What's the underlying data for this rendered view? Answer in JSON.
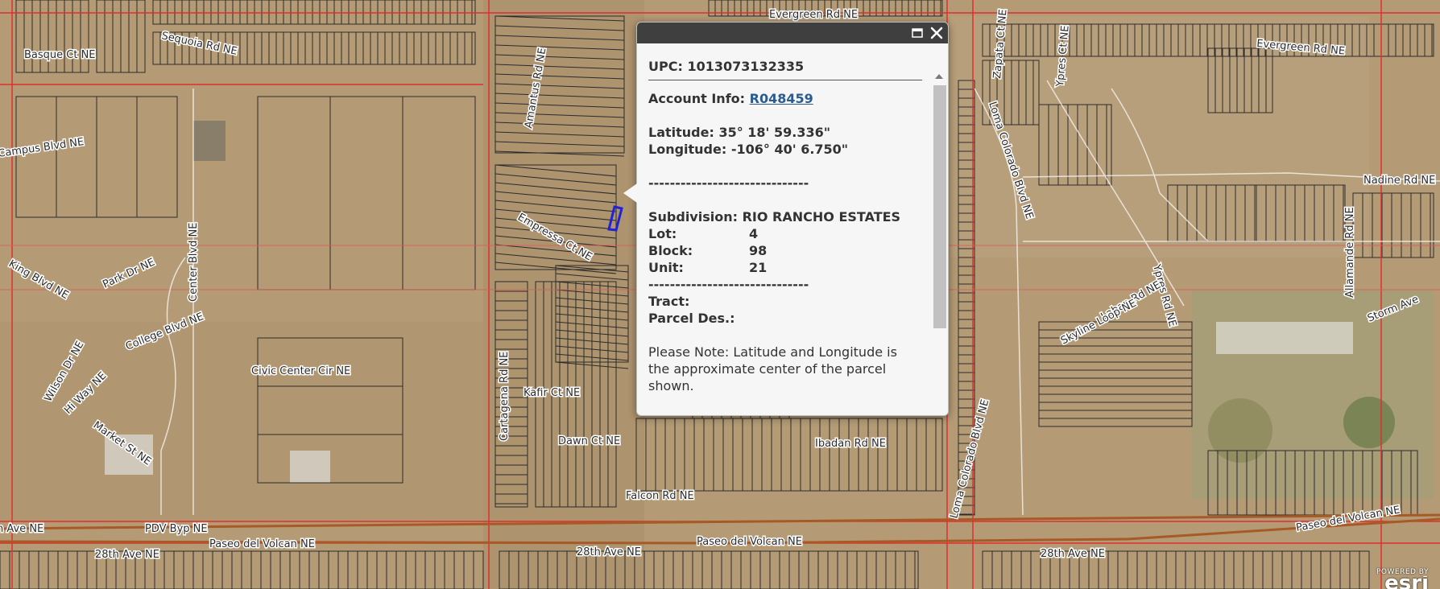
{
  "map": {
    "street_labels": [
      "Basque Ct NE",
      "Sequoia Rd NE",
      "Evergreen Rd NE",
      "Evergreen Rd NE",
      "Campus Blvd NE",
      "King Blvd NE",
      "Park Dr NE",
      "Center Blvd NE",
      "College Blvd NE",
      "Civic Center Cir NE",
      "Wilson Dr NE",
      "Hi Way NE",
      "Market St NE",
      "Amantus Rd NE",
      "Empressa Ct NE",
      "Cartagena Rd NE",
      "Kafir Ct NE",
      "Dawn Ct NE",
      "Ibadan Rd NE",
      "Falcon Rd NE",
      "Loma Colorado Blvd NE",
      "Loma Colorado Blvd NE",
      "Zapata Ct NE",
      "Ypres Ct NE",
      "Ypres Rd NE",
      "Nadine Rd NE",
      "Allamande Rd NE",
      "Storm Ave",
      "Laban Rd NE",
      "Skyline Loop NE",
      "PDV Byp NE",
      "Paseo del Volcan NE",
      "Paseo del Volcan NE",
      "Paseo del Volcan NE",
      "28th Ave NE",
      "28th Ave NE",
      "28th Ave NE",
      "n Ave NE"
    ],
    "selected_parcel_color": "#1f22d6",
    "boundary_color": "#e0302e",
    "road_color": "#a85a26"
  },
  "popup": {
    "upc_label": "UPC:",
    "upc_value": "1013073132335",
    "account_label": "Account Info:",
    "account_value": "R048459",
    "latitude_label": "Latitude:",
    "latitude_value": "35° 18' 59.336\"",
    "longitude_label": "Longitude:",
    "longitude_value": "-106° 40' 6.750\"",
    "divider": "------------------------------",
    "subdivision_label": "Subdivision:",
    "subdivision_value": "RIO RANCHO ESTATES",
    "lot_label": "Lot:",
    "lot_value": "4",
    "block_label": "Block:",
    "block_value": "98",
    "unit_label": "Unit:",
    "unit_value": "21",
    "divider2": "------------------------------",
    "tract_label": "Tract:",
    "parcel_des_label": "Parcel Des.:",
    "note": "Please Note: Latitude and Longitude is the approximate center of the parcel shown.",
    "maximize_icon": "maximize-icon",
    "close_icon": "close-icon"
  },
  "attribution": {
    "powered_by": "POWERED BY",
    "brand": "esri"
  }
}
